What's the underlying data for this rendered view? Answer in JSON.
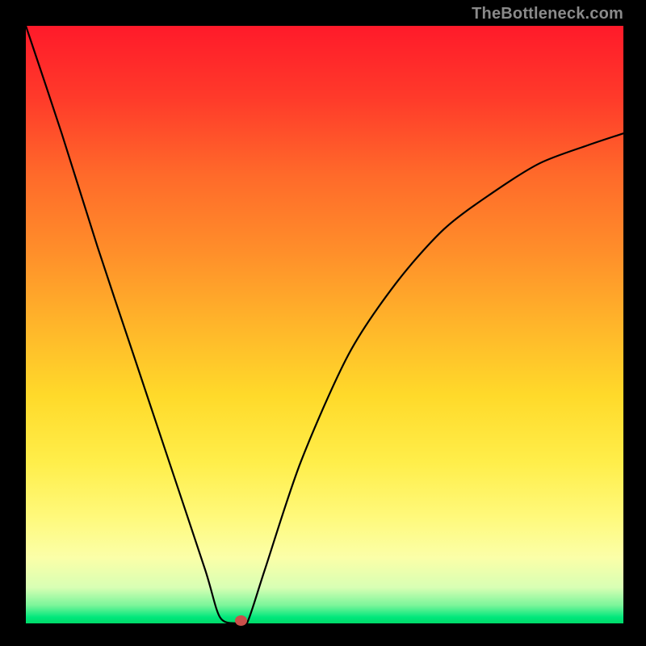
{
  "attribution": "TheBottleneck.com",
  "colors": {
    "frame": "#000000",
    "curve": "#000000",
    "dot": "#c94f4a",
    "gradient_top": "#ff1a2a",
    "gradient_mid": "#ffda2a",
    "gradient_bottom": "#00d968"
  },
  "chart_data": {
    "type": "line",
    "title": "",
    "xlabel": "",
    "ylabel": "",
    "xlim": [
      0,
      100
    ],
    "ylim": [
      0,
      100
    ],
    "series": [
      {
        "name": "bottleneck-curve",
        "x": [
          0,
          6,
          12,
          18,
          24,
          30,
          32.5,
          35.5,
          37,
          40,
          46,
          54,
          62,
          70,
          78,
          86,
          94,
          100
        ],
        "values": [
          100,
          82,
          63,
          45,
          27,
          9,
          1,
          0,
          0,
          9,
          27,
          45,
          57,
          66,
          72,
          77,
          80,
          82
        ]
      }
    ],
    "markers": [
      {
        "name": "optimum-point",
        "x": 36,
        "y": 0.5
      }
    ],
    "annotations": []
  }
}
